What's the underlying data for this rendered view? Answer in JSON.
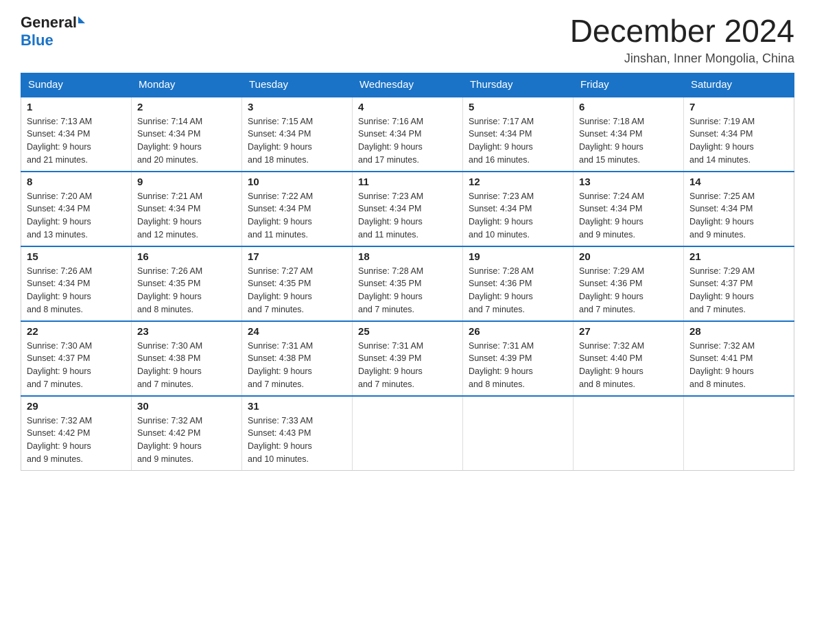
{
  "logo": {
    "general": "General",
    "blue": "Blue"
  },
  "title": "December 2024",
  "location": "Jinshan, Inner Mongolia, China",
  "headers": [
    "Sunday",
    "Monday",
    "Tuesday",
    "Wednesday",
    "Thursday",
    "Friday",
    "Saturday"
  ],
  "weeks": [
    [
      {
        "day": "1",
        "sunrise": "7:13 AM",
        "sunset": "4:34 PM",
        "daylight": "9 hours and 21 minutes."
      },
      {
        "day": "2",
        "sunrise": "7:14 AM",
        "sunset": "4:34 PM",
        "daylight": "9 hours and 20 minutes."
      },
      {
        "day": "3",
        "sunrise": "7:15 AM",
        "sunset": "4:34 PM",
        "daylight": "9 hours and 18 minutes."
      },
      {
        "day": "4",
        "sunrise": "7:16 AM",
        "sunset": "4:34 PM",
        "daylight": "9 hours and 17 minutes."
      },
      {
        "day": "5",
        "sunrise": "7:17 AM",
        "sunset": "4:34 PM",
        "daylight": "9 hours and 16 minutes."
      },
      {
        "day": "6",
        "sunrise": "7:18 AM",
        "sunset": "4:34 PM",
        "daylight": "9 hours and 15 minutes."
      },
      {
        "day": "7",
        "sunrise": "7:19 AM",
        "sunset": "4:34 PM",
        "daylight": "9 hours and 14 minutes."
      }
    ],
    [
      {
        "day": "8",
        "sunrise": "7:20 AM",
        "sunset": "4:34 PM",
        "daylight": "9 hours and 13 minutes."
      },
      {
        "day": "9",
        "sunrise": "7:21 AM",
        "sunset": "4:34 PM",
        "daylight": "9 hours and 12 minutes."
      },
      {
        "day": "10",
        "sunrise": "7:22 AM",
        "sunset": "4:34 PM",
        "daylight": "9 hours and 11 minutes."
      },
      {
        "day": "11",
        "sunrise": "7:23 AM",
        "sunset": "4:34 PM",
        "daylight": "9 hours and 11 minutes."
      },
      {
        "day": "12",
        "sunrise": "7:23 AM",
        "sunset": "4:34 PM",
        "daylight": "9 hours and 10 minutes."
      },
      {
        "day": "13",
        "sunrise": "7:24 AM",
        "sunset": "4:34 PM",
        "daylight": "9 hours and 9 minutes."
      },
      {
        "day": "14",
        "sunrise": "7:25 AM",
        "sunset": "4:34 PM",
        "daylight": "9 hours and 9 minutes."
      }
    ],
    [
      {
        "day": "15",
        "sunrise": "7:26 AM",
        "sunset": "4:34 PM",
        "daylight": "9 hours and 8 minutes."
      },
      {
        "day": "16",
        "sunrise": "7:26 AM",
        "sunset": "4:35 PM",
        "daylight": "9 hours and 8 minutes."
      },
      {
        "day": "17",
        "sunrise": "7:27 AM",
        "sunset": "4:35 PM",
        "daylight": "9 hours and 7 minutes."
      },
      {
        "day": "18",
        "sunrise": "7:28 AM",
        "sunset": "4:35 PM",
        "daylight": "9 hours and 7 minutes."
      },
      {
        "day": "19",
        "sunrise": "7:28 AM",
        "sunset": "4:36 PM",
        "daylight": "9 hours and 7 minutes."
      },
      {
        "day": "20",
        "sunrise": "7:29 AM",
        "sunset": "4:36 PM",
        "daylight": "9 hours and 7 minutes."
      },
      {
        "day": "21",
        "sunrise": "7:29 AM",
        "sunset": "4:37 PM",
        "daylight": "9 hours and 7 minutes."
      }
    ],
    [
      {
        "day": "22",
        "sunrise": "7:30 AM",
        "sunset": "4:37 PM",
        "daylight": "9 hours and 7 minutes."
      },
      {
        "day": "23",
        "sunrise": "7:30 AM",
        "sunset": "4:38 PM",
        "daylight": "9 hours and 7 minutes."
      },
      {
        "day": "24",
        "sunrise": "7:31 AM",
        "sunset": "4:38 PM",
        "daylight": "9 hours and 7 minutes."
      },
      {
        "day": "25",
        "sunrise": "7:31 AM",
        "sunset": "4:39 PM",
        "daylight": "9 hours and 7 minutes."
      },
      {
        "day": "26",
        "sunrise": "7:31 AM",
        "sunset": "4:39 PM",
        "daylight": "9 hours and 8 minutes."
      },
      {
        "day": "27",
        "sunrise": "7:32 AM",
        "sunset": "4:40 PM",
        "daylight": "9 hours and 8 minutes."
      },
      {
        "day": "28",
        "sunrise": "7:32 AM",
        "sunset": "4:41 PM",
        "daylight": "9 hours and 8 minutes."
      }
    ],
    [
      {
        "day": "29",
        "sunrise": "7:32 AM",
        "sunset": "4:42 PM",
        "daylight": "9 hours and 9 minutes."
      },
      {
        "day": "30",
        "sunrise": "7:32 AM",
        "sunset": "4:42 PM",
        "daylight": "9 hours and 9 minutes."
      },
      {
        "day": "31",
        "sunrise": "7:33 AM",
        "sunset": "4:43 PM",
        "daylight": "9 hours and 10 minutes."
      },
      null,
      null,
      null,
      null
    ]
  ],
  "labels": {
    "sunrise": "Sunrise:",
    "sunset": "Sunset:",
    "daylight": "Daylight:"
  }
}
